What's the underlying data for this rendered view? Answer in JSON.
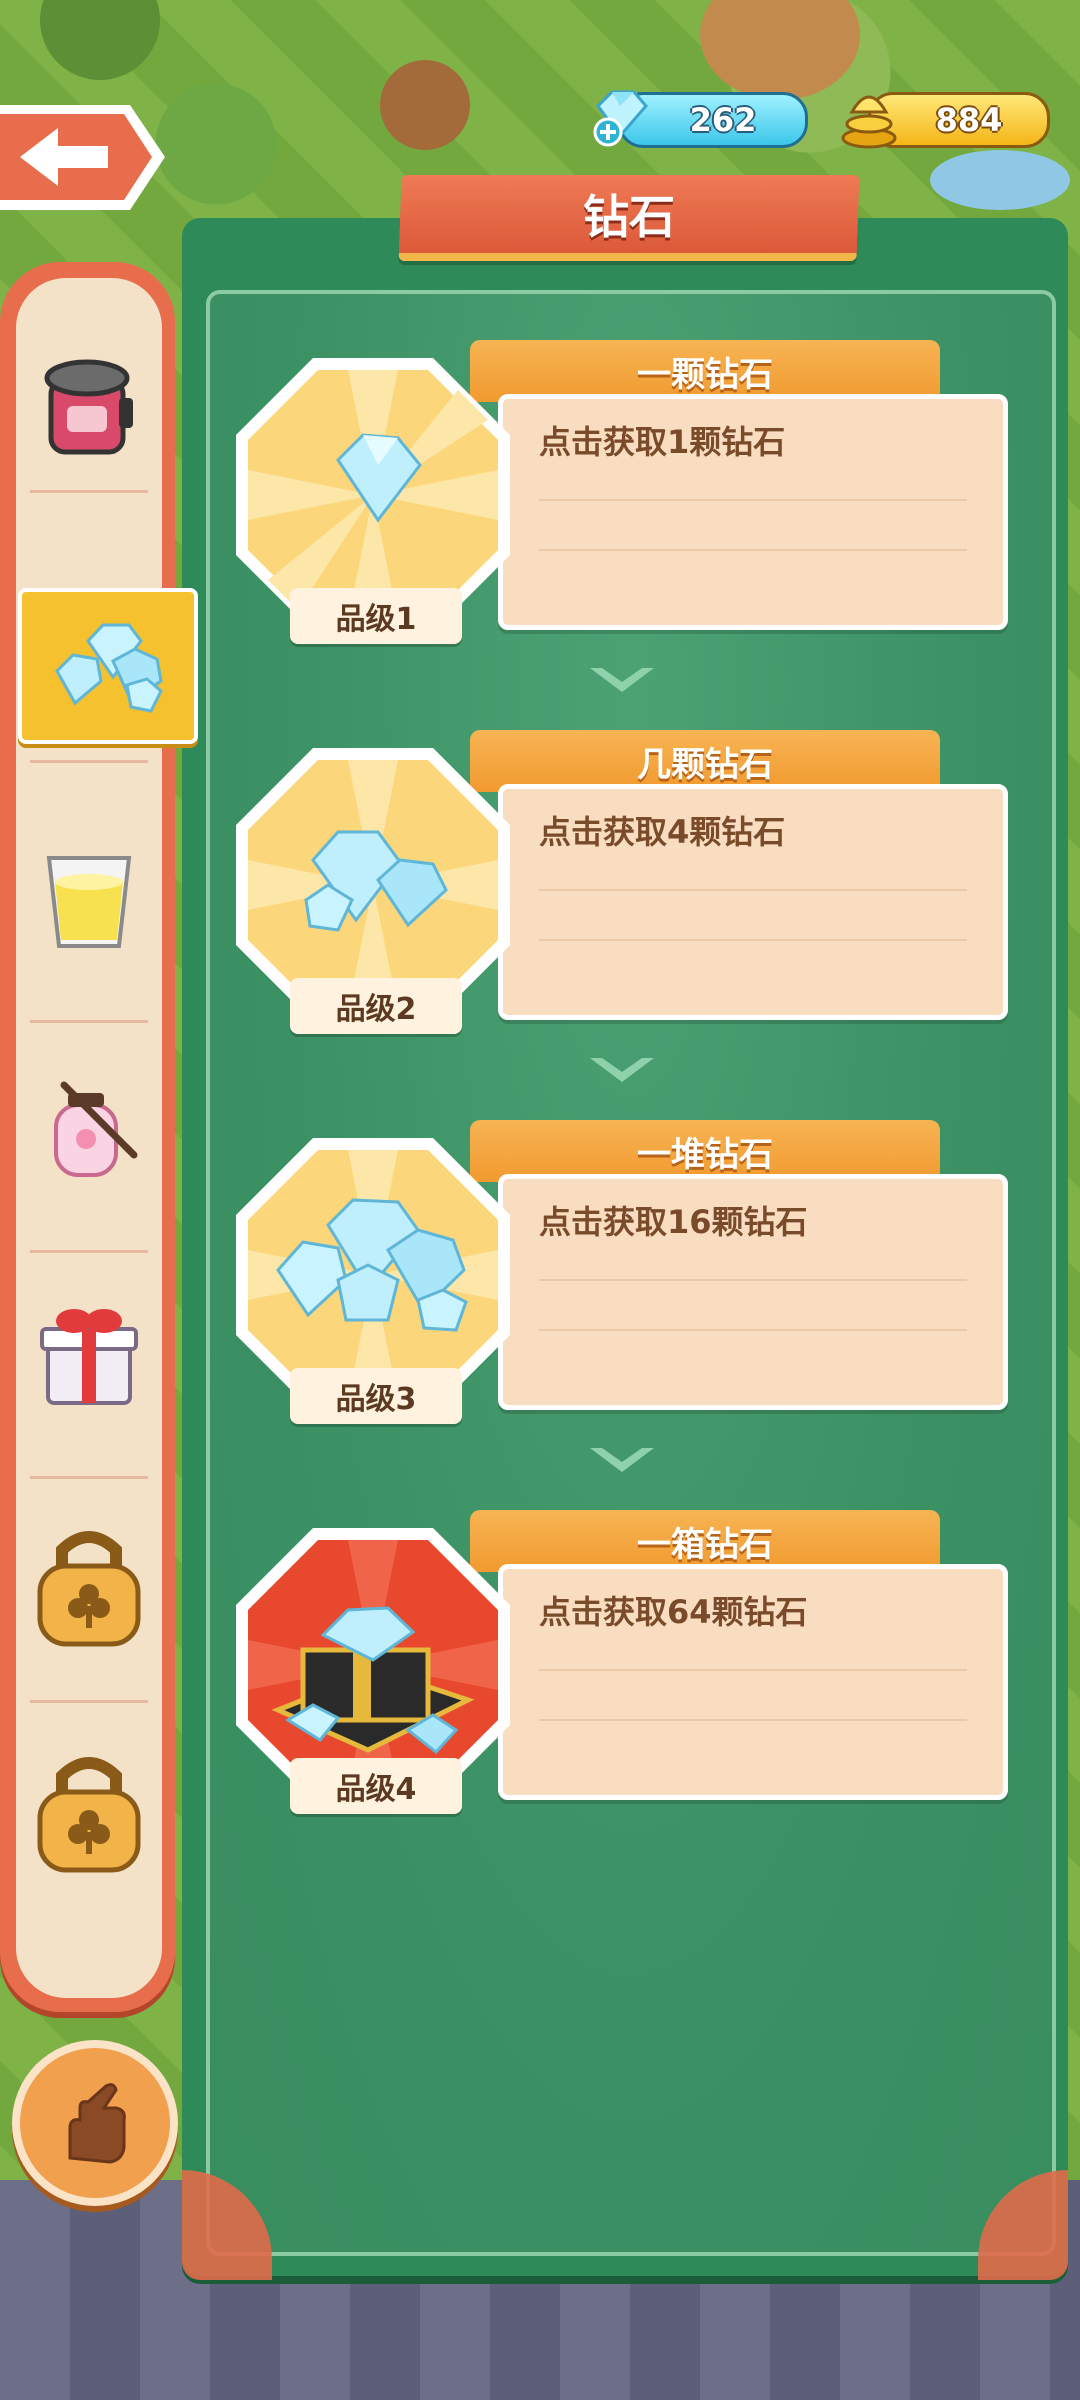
{
  "currency": {
    "gems": "262",
    "gold": "884"
  },
  "title": "钻石",
  "icons": {
    "back": "back-arrow-icon",
    "gem_add": "gem-plus-icon",
    "gold": "gold-coin-icon",
    "hand": "pointing-hand-icon"
  },
  "sidebar": {
    "items": [
      {
        "icon": "cooker-icon",
        "active": false
      },
      {
        "icon": "diamond-pile-icon",
        "active": true
      },
      {
        "icon": "juice-glass-icon",
        "active": false
      },
      {
        "icon": "lantern-icon",
        "active": false
      },
      {
        "icon": "gift-box-icon",
        "active": false
      },
      {
        "icon": "locked-icon",
        "active": false
      },
      {
        "icon": "locked-icon",
        "active": false
      }
    ]
  },
  "cards": [
    {
      "name": "一颗钻石",
      "desc": "点击获取1颗钻石",
      "tier": "品级1"
    },
    {
      "name": "几颗钻石",
      "desc": "点击获取4颗钻石",
      "tier": "品级2"
    },
    {
      "name": "一堆钻石",
      "desc": "点击获取16颗钻石",
      "tier": "品级3"
    },
    {
      "name": "一箱钻石",
      "desc": "点击获取64颗钻石",
      "tier": "品级4"
    }
  ],
  "colors": {
    "panel_green": "#2e8a58",
    "title_red": "#dc5a39",
    "tab_orange": "#f19a2f",
    "active_yellow": "#f5c12e"
  }
}
